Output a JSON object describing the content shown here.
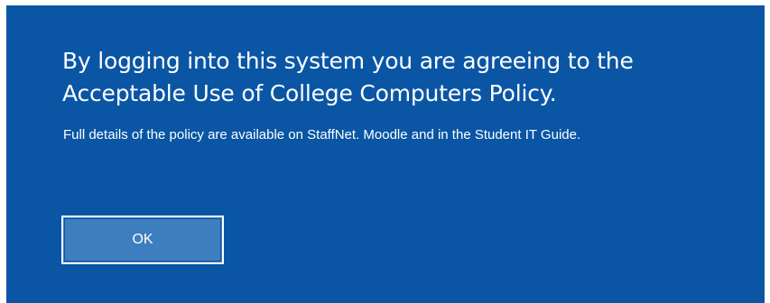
{
  "dialog": {
    "headline": "By logging into this system you are agreeing to the Acceptable Use of College Computers Policy.",
    "details": "Full details of the policy are available on StaffNet. Moodle and in the Student IT Guide.",
    "ok_label": "OK"
  },
  "colors": {
    "background": "#0a56a5",
    "button": "#3d7ebf",
    "text": "#ffffff"
  }
}
